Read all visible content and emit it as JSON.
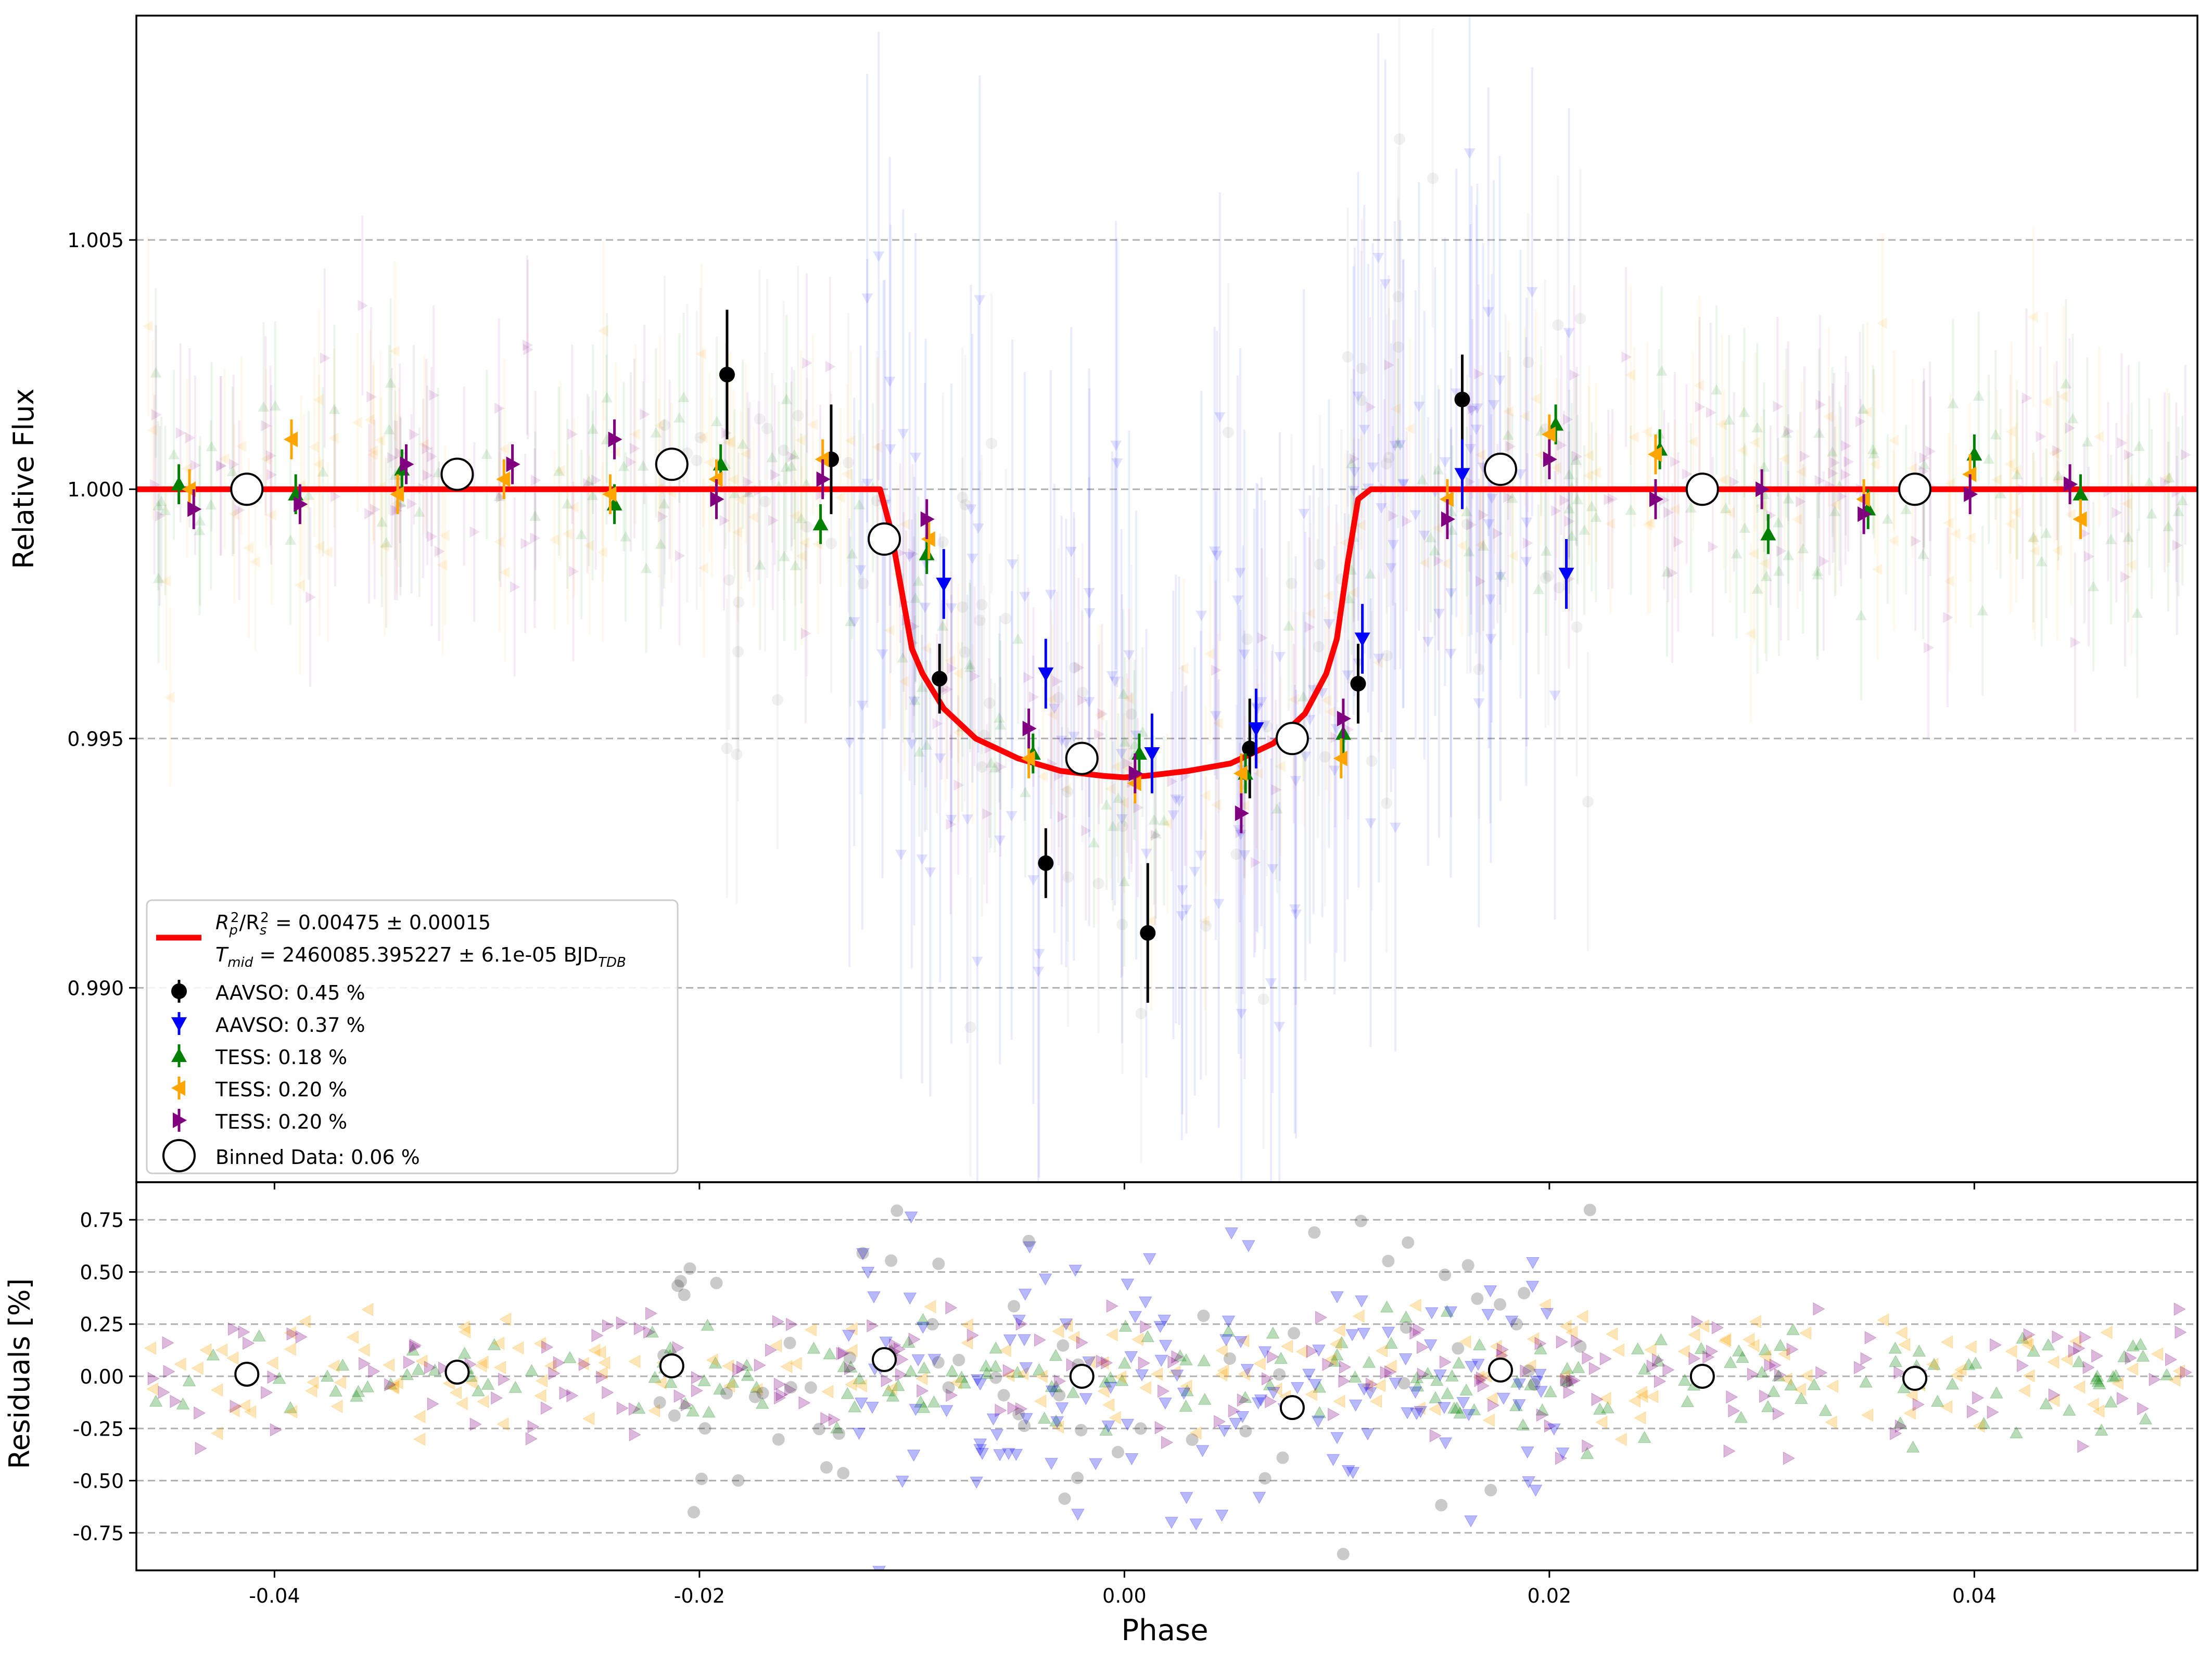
{
  "chart_data": [
    {
      "type": "scatter",
      "panel": "main",
      "ylabel": "Relative Flux",
      "xlim": [
        -0.0465,
        0.0505
      ],
      "ylim": [
        0.9861,
        1.0095
      ],
      "grid": "horizontal dashed",
      "x_ticks": [
        "-0.04",
        "-0.02",
        "0.00",
        "0.02",
        "0.04"
      ],
      "x_tick_values": [
        -0.04,
        -0.02,
        0.0,
        0.02,
        0.04
      ],
      "y_ticks": [
        "0.990",
        "0.995",
        "1.000",
        "1.005"
      ],
      "y_tick_values": [
        0.99,
        0.995,
        1.0,
        1.005
      ],
      "legend_position": "lower-left",
      "model": {
        "name": "R_p^2/R_s^2 = 0.00475 ± 0.00015",
        "label_depth_left": "R",
        "label_depth_mid": "/R",
        "label_depth_right": " = 0.00475 ± 0.00015",
        "label_tmid_left": "T",
        "label_tmid_sub": "mid",
        "label_tmid_right": " = 2460085.395227 ± 6.1e-05 BJD",
        "label_tmid_unit_sub": "TDB",
        "color": "#ff0000",
        "depth": 0.0058,
        "ingress_start": -0.0115,
        "ingress_end": -0.0095,
        "egress_start": 0.0098,
        "egress_end": 0.0116,
        "x": [
          -0.0465,
          -0.0115,
          -0.011,
          -0.0105,
          -0.01,
          -0.0095,
          -0.0085,
          -0.007,
          -0.005,
          -0.003,
          -0.001,
          0.0,
          0.001,
          0.003,
          0.005,
          0.007,
          0.0085,
          0.0095,
          0.01,
          0.0105,
          0.011,
          0.0116,
          0.0505
        ],
        "y": [
          1.0,
          1.0,
          0.9992,
          0.998,
          0.9968,
          0.9963,
          0.9956,
          0.995,
          0.9946,
          0.99435,
          0.99425,
          0.99422,
          0.99425,
          0.99435,
          0.9945,
          0.9949,
          0.9955,
          0.9963,
          0.997,
          0.9985,
          0.9998,
          1.0,
          1.0
        ]
      },
      "series": [
        {
          "name": "AAVSO: 0.45 %",
          "marker": "circle",
          "color": "#000000",
          "points": [
            {
              "x": -0.0187,
              "y": 1.0023,
              "err": 0.0013
            },
            {
              "x": -0.0138,
              "y": 1.0006,
              "err": 0.0011
            },
            {
              "x": -0.0087,
              "y": 0.9962,
              "err": 0.0007
            },
            {
              "x": -0.0037,
              "y": 0.9925,
              "err": 0.0007
            },
            {
              "x": 0.0011,
              "y": 0.9911,
              "err": 0.0014
            },
            {
              "x": 0.0059,
              "y": 0.9948,
              "err": 0.001
            },
            {
              "x": 0.011,
              "y": 0.9961,
              "err": 0.0008
            },
            {
              "x": 0.0159,
              "y": 1.0018,
              "err": 0.0009
            }
          ]
        },
        {
          "name": "AAVSO: 0.37 %",
          "marker": "triangle-down",
          "color": "#0000ff",
          "points": [
            {
              "x": -0.0085,
              "y": 0.9981,
              "err": 0.0007
            },
            {
              "x": -0.0037,
              "y": 0.9963,
              "err": 0.0007
            },
            {
              "x": 0.0013,
              "y": 0.9947,
              "err": 0.0008
            },
            {
              "x": 0.0062,
              "y": 0.9952,
              "err": 0.0008
            },
            {
              "x": 0.0112,
              "y": 0.997,
              "err": 0.0007
            },
            {
              "x": 0.0159,
              "y": 1.0003,
              "err": 0.0007
            },
            {
              "x": 0.0208,
              "y": 0.9983,
              "err": 0.0007
            }
          ]
        },
        {
          "name": "TESS: 0.18 %",
          "marker": "triangle-up",
          "color": "#008000",
          "points": [
            {
              "x": -0.0445,
              "y": 1.0001,
              "err": 0.0004
            },
            {
              "x": -0.039,
              "y": 0.9999,
              "err": 0.0004
            },
            {
              "x": -0.034,
              "y": 1.0004,
              "err": 0.0004
            },
            {
              "x": -0.024,
              "y": 0.9997,
              "err": 0.0004
            },
            {
              "x": -0.019,
              "y": 1.0005,
              "err": 0.0004
            },
            {
              "x": -0.0143,
              "y": 0.9993,
              "err": 0.0004
            },
            {
              "x": -0.0093,
              "y": 0.9987,
              "err": 0.0004
            },
            {
              "x": -0.0043,
              "y": 0.9947,
              "err": 0.0004
            },
            {
              "x": 0.0007,
              "y": 0.9947,
              "err": 0.0004
            },
            {
              "x": 0.0057,
              "y": 0.9943,
              "err": 0.0004
            },
            {
              "x": 0.0103,
              "y": 0.9951,
              "err": 0.0004
            },
            {
              "x": 0.0203,
              "y": 1.0013,
              "err": 0.0004
            },
            {
              "x": 0.0252,
              "y": 1.0008,
              "err": 0.0004
            },
            {
              "x": 0.0303,
              "y": 0.9991,
              "err": 0.0004
            },
            {
              "x": 0.035,
              "y": 0.9996,
              "err": 0.0004
            },
            {
              "x": 0.04,
              "y": 1.0007,
              "err": 0.0004
            },
            {
              "x": 0.045,
              "y": 0.9999,
              "err": 0.0004
            }
          ]
        },
        {
          "name": "TESS: 0.20 %",
          "marker": "triangle-left",
          "color": "#ffa500",
          "points": [
            {
              "x": -0.044,
              "y": 1.0,
              "err": 0.0004
            },
            {
              "x": -0.0392,
              "y": 1.001,
              "err": 0.0004
            },
            {
              "x": -0.0342,
              "y": 0.9999,
              "err": 0.0004
            },
            {
              "x": -0.0292,
              "y": 1.0002,
              "err": 0.0004
            },
            {
              "x": -0.0242,
              "y": 0.9999,
              "err": 0.0004
            },
            {
              "x": -0.0192,
              "y": 1.0002,
              "err": 0.0004
            },
            {
              "x": -0.0142,
              "y": 1.0006,
              "err": 0.0004
            },
            {
              "x": -0.0092,
              "y": 0.999,
              "err": 0.0004
            },
            {
              "x": -0.0045,
              "y": 0.9946,
              "err": 0.0004
            },
            {
              "x": 0.0005,
              "y": 0.9941,
              "err": 0.0004
            },
            {
              "x": 0.0055,
              "y": 0.9943,
              "err": 0.0004
            },
            {
              "x": 0.0102,
              "y": 0.9946,
              "err": 0.0004
            },
            {
              "x": 0.0152,
              "y": 0.9998,
              "err": 0.0004
            },
            {
              "x": 0.02,
              "y": 1.0011,
              "err": 0.0004
            },
            {
              "x": 0.025,
              "y": 1.0007,
              "err": 0.0004
            },
            {
              "x": 0.0348,
              "y": 0.9998,
              "err": 0.0004
            },
            {
              "x": 0.0398,
              "y": 1.0003,
              "err": 0.0004
            },
            {
              "x": 0.045,
              "y": 0.9994,
              "err": 0.0004
            }
          ]
        },
        {
          "name": "TESS: 0.20 %",
          "marker": "triangle-right",
          "color": "#800080",
          "points": [
            {
              "x": -0.0438,
              "y": 0.9996,
              "err": 0.0004
            },
            {
              "x": -0.0388,
              "y": 0.9997,
              "err": 0.0004
            },
            {
              "x": -0.0338,
              "y": 1.0005,
              "err": 0.0004
            },
            {
              "x": -0.0288,
              "y": 1.0005,
              "err": 0.0004
            },
            {
              "x": -0.024,
              "y": 1.001,
              "err": 0.0004
            },
            {
              "x": -0.0192,
              "y": 0.9998,
              "err": 0.0004
            },
            {
              "x": -0.0142,
              "y": 1.0002,
              "err": 0.0004
            },
            {
              "x": -0.0093,
              "y": 0.9994,
              "err": 0.0004
            },
            {
              "x": -0.0045,
              "y": 0.9952,
              "err": 0.0004
            },
            {
              "x": 0.0005,
              "y": 0.9943,
              "err": 0.0004
            },
            {
              "x": 0.0055,
              "y": 0.9935,
              "err": 0.0004
            },
            {
              "x": 0.0103,
              "y": 0.9954,
              "err": 0.0004
            },
            {
              "x": 0.0152,
              "y": 0.9994,
              "err": 0.0004
            },
            {
              "x": 0.02,
              "y": 1.0006,
              "err": 0.0004
            },
            {
              "x": 0.025,
              "y": 0.9998,
              "err": 0.0004
            },
            {
              "x": 0.03,
              "y": 1.0,
              "err": 0.0004
            },
            {
              "x": 0.0348,
              "y": 0.9995,
              "err": 0.0004
            },
            {
              "x": 0.0398,
              "y": 0.9999,
              "err": 0.0004
            },
            {
              "x": 0.0445,
              "y": 1.0001,
              "err": 0.0004
            }
          ]
        },
        {
          "name": "Binned Data: 0.06 %",
          "marker": "open-circle",
          "color": "#000000",
          "points": [
            {
              "x": -0.0413,
              "y": 1.0
            },
            {
              "x": -0.0314,
              "y": 1.0003
            },
            {
              "x": -0.0213,
              "y": 1.0005
            },
            {
              "x": -0.0113,
              "y": 0.999
            },
            {
              "x": -0.002,
              "y": 0.9946
            },
            {
              "x": 0.0079,
              "y": 0.995
            },
            {
              "x": 0.0177,
              "y": 1.0004
            },
            {
              "x": 0.0272,
              "y": 1.0
            },
            {
              "x": 0.0372,
              "y": 1.0
            }
          ]
        }
      ]
    },
    {
      "type": "scatter",
      "panel": "residuals",
      "xlabel": "Phase",
      "ylabel": "Residuals [%]",
      "xlim": [
        -0.0465,
        0.0505
      ],
      "ylim": [
        -0.93,
        0.93
      ],
      "grid": "horizontal dashed",
      "x_ticks": [
        "-0.04",
        "-0.02",
        "0.00",
        "0.02",
        "0.04"
      ],
      "x_tick_values": [
        -0.04,
        -0.02,
        0.0,
        0.02,
        0.04
      ],
      "y_ticks": [
        "-0.75",
        "-0.50",
        "-0.25",
        "0.00",
        "0.25",
        "0.50",
        "0.75"
      ],
      "y_tick_values": [
        -0.75,
        -0.5,
        -0.25,
        0.0,
        0.25,
        0.5,
        0.75
      ],
      "binned_residuals": {
        "name": "Binned Data",
        "x": [
          -0.0413,
          -0.0314,
          -0.0213,
          -0.0113,
          -0.002,
          0.0079,
          0.0177,
          0.0272,
          0.0372
        ],
        "y": [
          0.01,
          0.02,
          0.05,
          0.08,
          0.0,
          -0.15,
          0.03,
          0.0,
          -0.01
        ]
      }
    }
  ]
}
